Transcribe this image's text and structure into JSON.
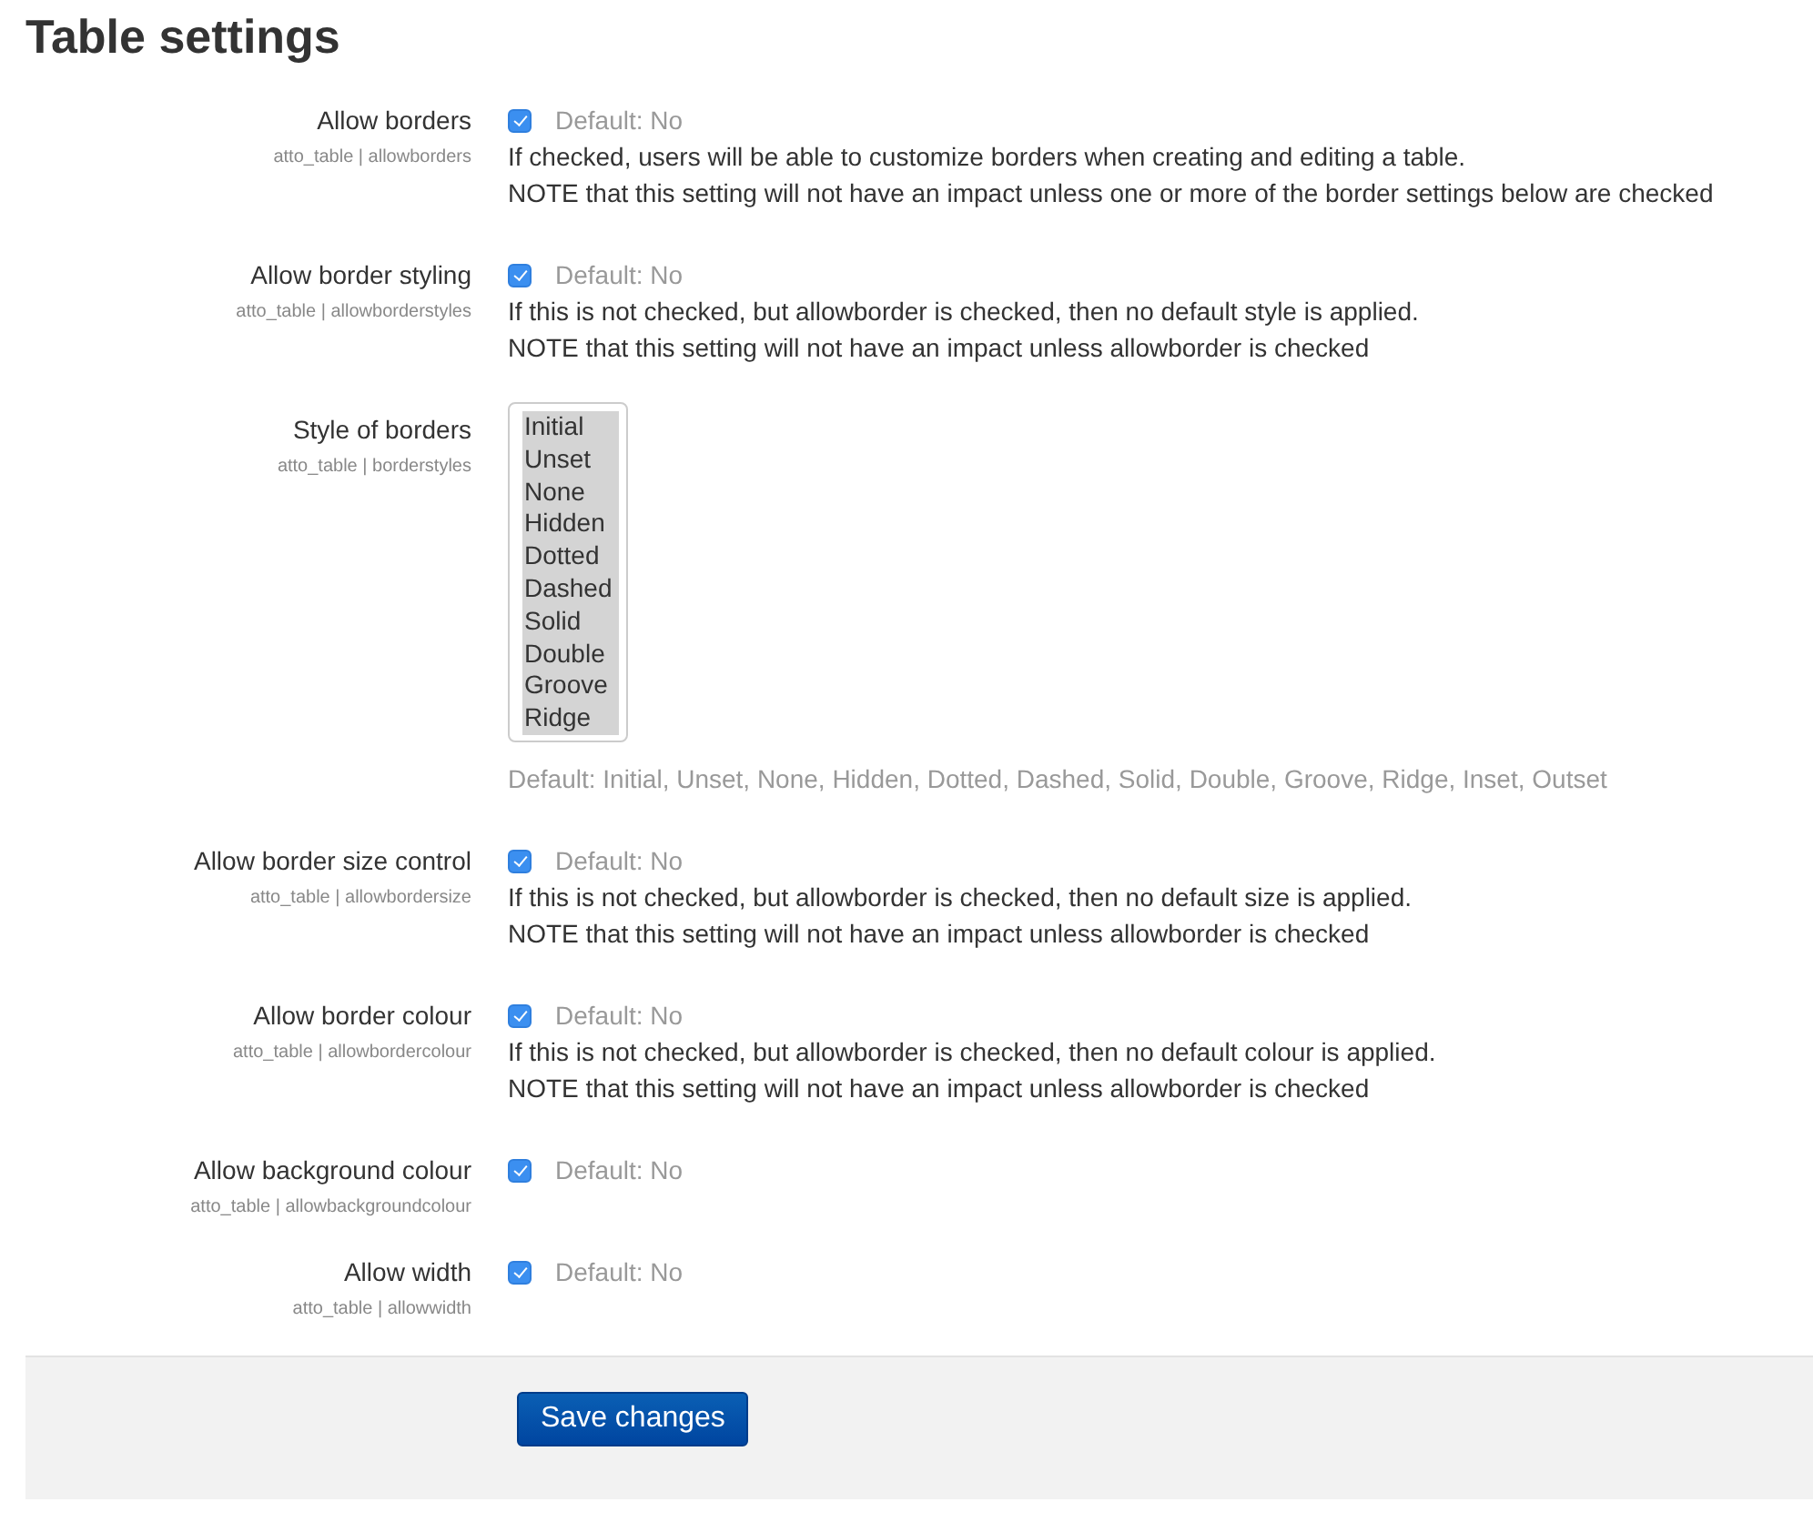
{
  "title": "Table settings",
  "settings": [
    {
      "kind": "checkbox",
      "label": "Allow borders",
      "key": "atto_table | allowborders",
      "checked": true,
      "default": "Default: No",
      "description": [
        "If checked, users will be able to customize borders when creating and editing a table.",
        "NOTE that this setting will not have an impact unless one or more of the border settings below are checked"
      ]
    },
    {
      "kind": "checkbox",
      "label": "Allow border styling",
      "key": "atto_table | allowborderstyles",
      "checked": true,
      "default": "Default: No",
      "description": [
        "If this is not checked, but allowborder is checked, then no default style is applied.",
        "NOTE that this setting will not have an impact unless allowborder is checked"
      ]
    },
    {
      "kind": "multiselect",
      "label": "Style of borders",
      "key": "atto_table | borderstyles",
      "options": [
        {
          "label": "Initial",
          "selected": true
        },
        {
          "label": "Unset",
          "selected": true
        },
        {
          "label": "None",
          "selected": true
        },
        {
          "label": "Hidden",
          "selected": true
        },
        {
          "label": "Dotted",
          "selected": true
        },
        {
          "label": "Dashed",
          "selected": true
        },
        {
          "label": "Solid",
          "selected": true
        },
        {
          "label": "Double",
          "selected": true
        },
        {
          "label": "Groove",
          "selected": true
        },
        {
          "label": "Ridge",
          "selected": true
        }
      ],
      "default": "Default: Initial, Unset, None, Hidden, Dotted, Dashed, Solid, Double, Groove, Ridge, Inset, Outset"
    },
    {
      "kind": "checkbox",
      "label": "Allow border size control",
      "key": "atto_table | allowbordersize",
      "checked": true,
      "default": "Default: No",
      "description": [
        "If this is not checked, but allowborder is checked, then no default size is applied.",
        "NOTE that this setting will not have an impact unless allowborder is checked"
      ]
    },
    {
      "kind": "checkbox",
      "label": "Allow border colour",
      "key": "atto_table | allowbordercolour",
      "checked": true,
      "default": "Default: No",
      "description": [
        "If this is not checked, but allowborder is checked, then no default colour is applied.",
        "NOTE that this setting will not have an impact unless allowborder is checked"
      ]
    },
    {
      "kind": "checkbox",
      "label": "Allow background colour",
      "key": "atto_table | allowbackgroundcolour",
      "checked": true,
      "default": "Default: No"
    },
    {
      "kind": "checkbox",
      "label": "Allow width",
      "key": "atto_table | allowwidth",
      "checked": true,
      "default": "Default: No"
    }
  ],
  "save_button": "Save changes"
}
